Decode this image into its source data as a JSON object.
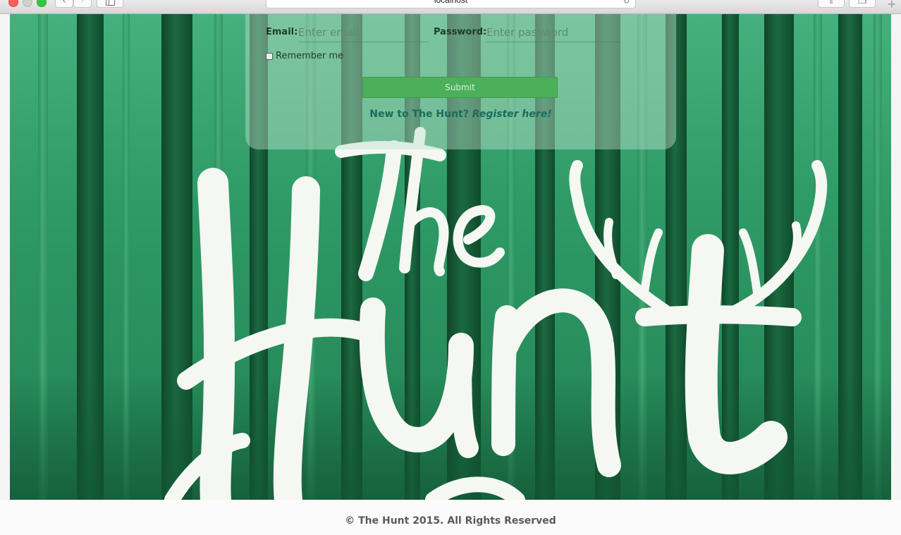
{
  "browser": {
    "url": "localhost"
  },
  "login": {
    "email_label": "Email:",
    "email_placeholder": "Enter email",
    "password_label": "Password:",
    "password_placeholder": "Enter password",
    "remember_label": "Remember me",
    "submit_label": "Submit",
    "register_prompt": "New to The Hunt?",
    "register_link": "Register here!"
  },
  "logo": {
    "text": "The Hunt"
  },
  "footer": {
    "copyright": "© The Hunt 2015. All Rights Reserved"
  },
  "colors": {
    "hero_green": "#2e9a66",
    "submit_green": "#4caf5a",
    "register_link": "#1b6a5a"
  }
}
